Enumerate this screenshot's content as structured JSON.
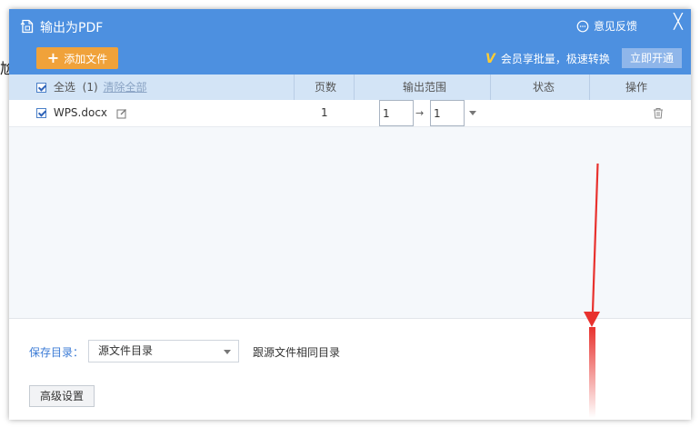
{
  "background": {
    "edge_text": "尬"
  },
  "dialog": {
    "title": "输出为PDF",
    "feedback_label": "意见反馈",
    "close_symbol": "╳"
  },
  "toolbar": {
    "add_file_label": "添加文件",
    "vip_text": "会员享批量，极速转换",
    "open_now_label": "立即开通"
  },
  "table": {
    "select_all_label": "全选",
    "select_all_count": "(1)",
    "clear_all_label": "清除全部",
    "headers": {
      "pages": "页数",
      "range": "输出范围",
      "status": "状态",
      "actions": "操作"
    },
    "rows": [
      {
        "name": "WPS.docx",
        "checked": true,
        "pages": "1",
        "range_from": "1",
        "range_to": "1",
        "range_arrow": "→",
        "status": ""
      }
    ]
  },
  "save": {
    "label": "保存目录：",
    "selected": "源文件目录",
    "hint": "跟源文件相同目录"
  },
  "advanced_label": "高级设置",
  "colors": {
    "titlebar": "#4d90e0",
    "add_button": "#f0a23a",
    "open_button": "#8fb6ea",
    "header_row": "#d3e4f6",
    "annotation_arrow": "#e8322e"
  }
}
